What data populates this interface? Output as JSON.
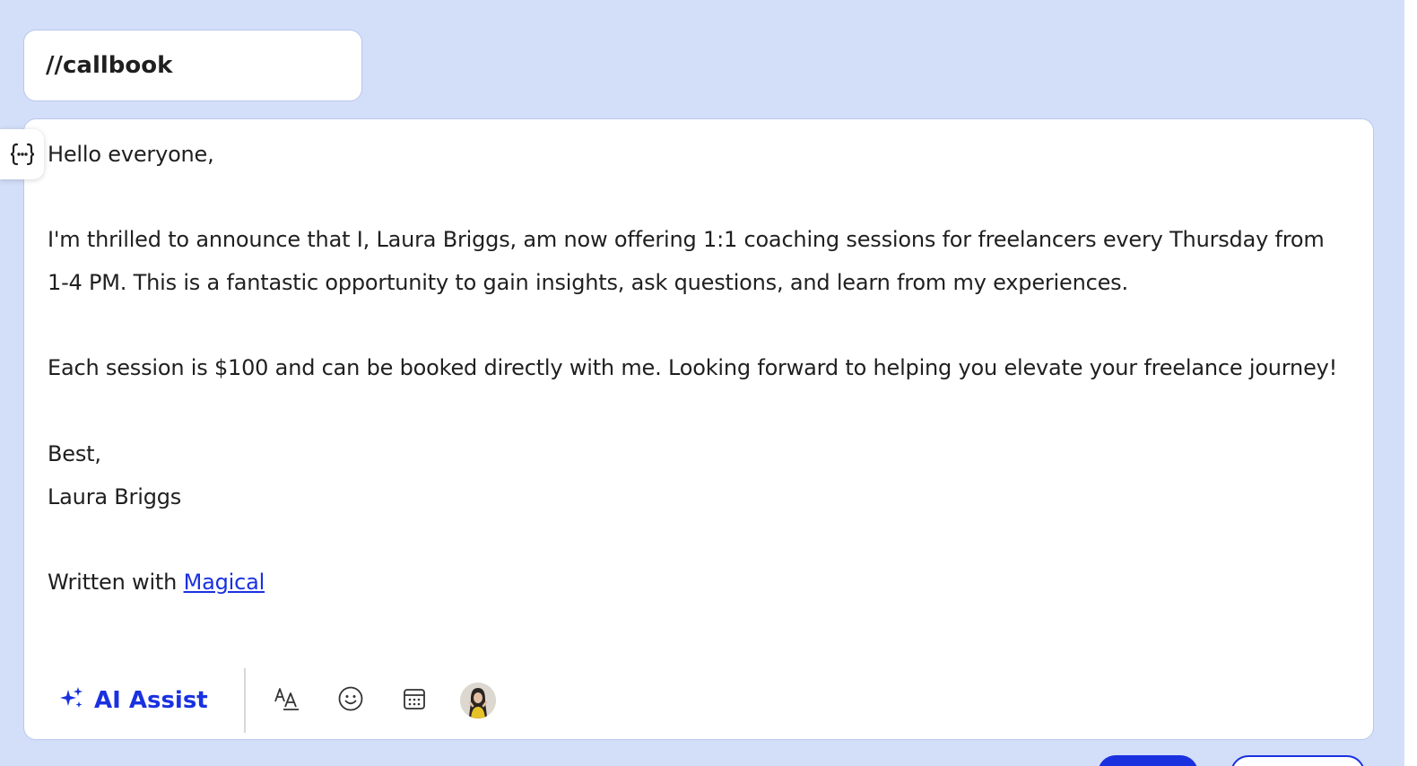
{
  "shortcut": {
    "value": "//callbook"
  },
  "message": {
    "greeting": "Hello everyone,",
    "paragraph1": "I'm thrilled to announce that I, Laura Briggs, am now offering 1:1 coaching sessions for freelancers every Thursday from 1-4 PM. This is a fantastic opportunity to gain insights, ask questions, and learn from my experiences.",
    "paragraph2": "Each session is $100 and can be booked directly with me. Looking forward to helping you elevate your freelance journey!",
    "signoff": "Best,",
    "signature": "Laura Briggs",
    "written_with_prefix": "Written with ",
    "written_with_link": "Magical"
  },
  "toolbar": {
    "ai_assist_label": "AI Assist",
    "icons": [
      "sparkles-icon",
      "text-format-icon",
      "emoji-icon",
      "calendar-icon",
      "avatar"
    ]
  },
  "colors": {
    "background": "#d3def9",
    "accent": "#1a31e0",
    "text": "#1f1f1f"
  }
}
